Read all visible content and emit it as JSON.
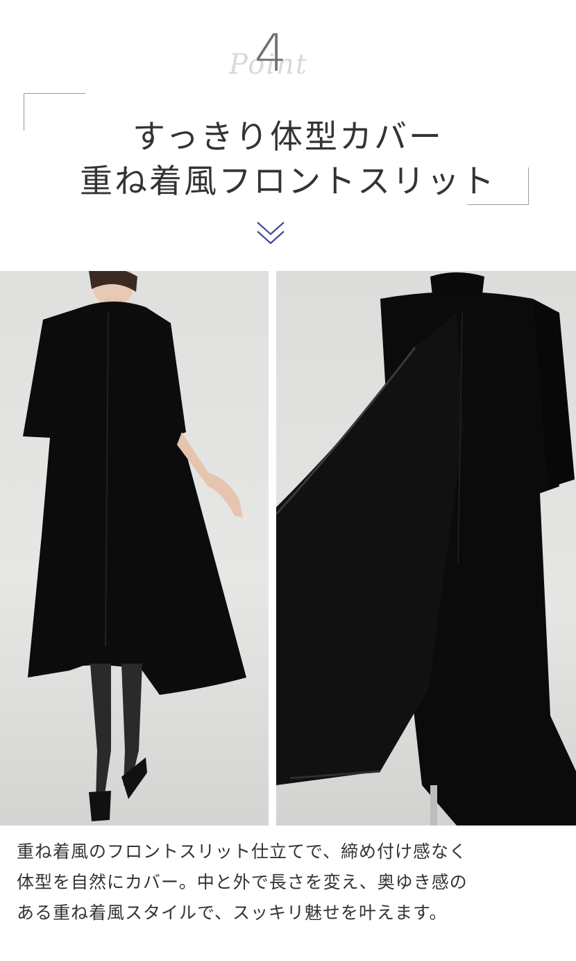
{
  "header": {
    "point_script": "Point",
    "point_number": "4",
    "title_line1": "すっきり体型カバー",
    "title_line2": "重ね着風フロントスリット"
  },
  "chevron_icon": "double-chevron-down-icon",
  "colors": {
    "accent": "#3a4a9e",
    "text": "#333333",
    "dress": "#0b0b0b"
  },
  "photos": [
    {
      "name": "model-wearing-dress-photo"
    },
    {
      "name": "dress-on-mannequin-open-slit-photo"
    }
  ],
  "description": {
    "line1": "重ね着風のフロントスリット仕立てで、締め付け感なく",
    "line2": "体型を自然にカバー。中と外で長さを変え、奥ゆき感の",
    "line3": "ある重ね着風スタイルで、スッキリ魅せを叶えます。"
  }
}
